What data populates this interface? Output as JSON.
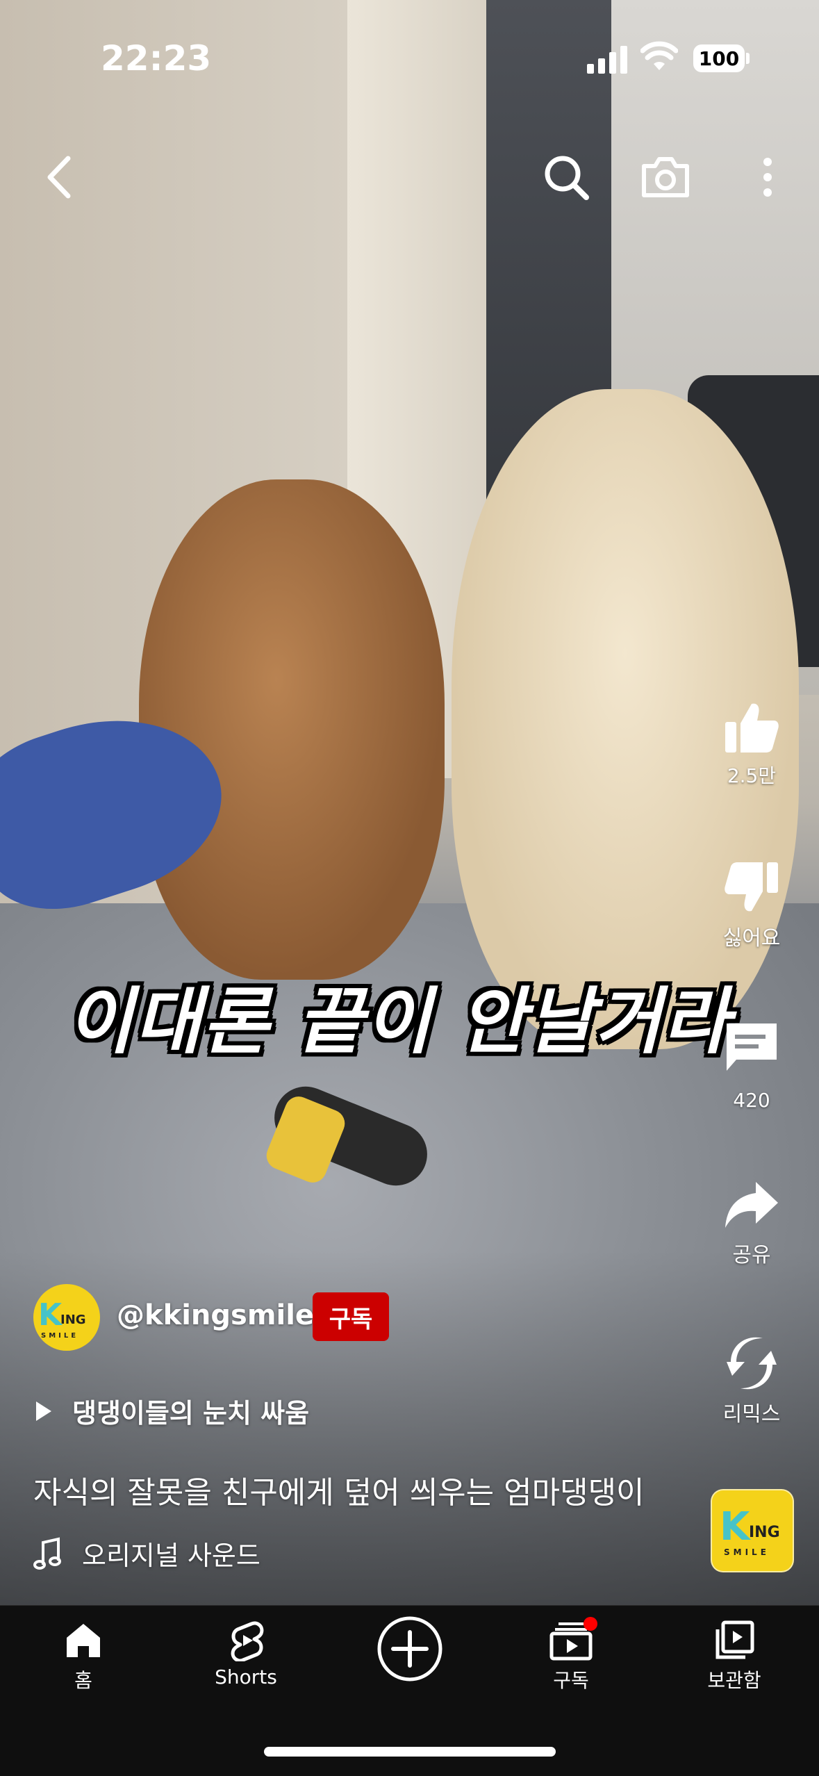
{
  "status_bar": {
    "time": "22:23",
    "battery": "100"
  },
  "top_bar": {
    "icons": [
      "back-icon",
      "search-icon",
      "camera-icon",
      "more-icon"
    ]
  },
  "video": {
    "caption": "이대론 끝이 안날거라"
  },
  "actions": {
    "like_count": "2.5만",
    "dislike_label": "싫어요",
    "comment_count": "420",
    "share_label": "공유",
    "remix_label": "리믹스"
  },
  "channel": {
    "handle": "@kkingsmile",
    "subscribe_label": "구독",
    "avatar_text": "King"
  },
  "playlist": {
    "label": "댕댕이들의 눈치 싸움"
  },
  "video_title": "자식의 잘못을 친구에게 덮어 씌우는 엄마댕댕이",
  "sound": {
    "label": "오리지널 사운드"
  },
  "nav": {
    "home": "홈",
    "shorts": "Shorts",
    "subscriptions": "구독",
    "library": "보관함"
  },
  "colors": {
    "subscribe": "#cc0000",
    "nav_bg": "#0f0f0f",
    "badge": "#ff0000",
    "logo_yellow": "#f4d21a"
  }
}
